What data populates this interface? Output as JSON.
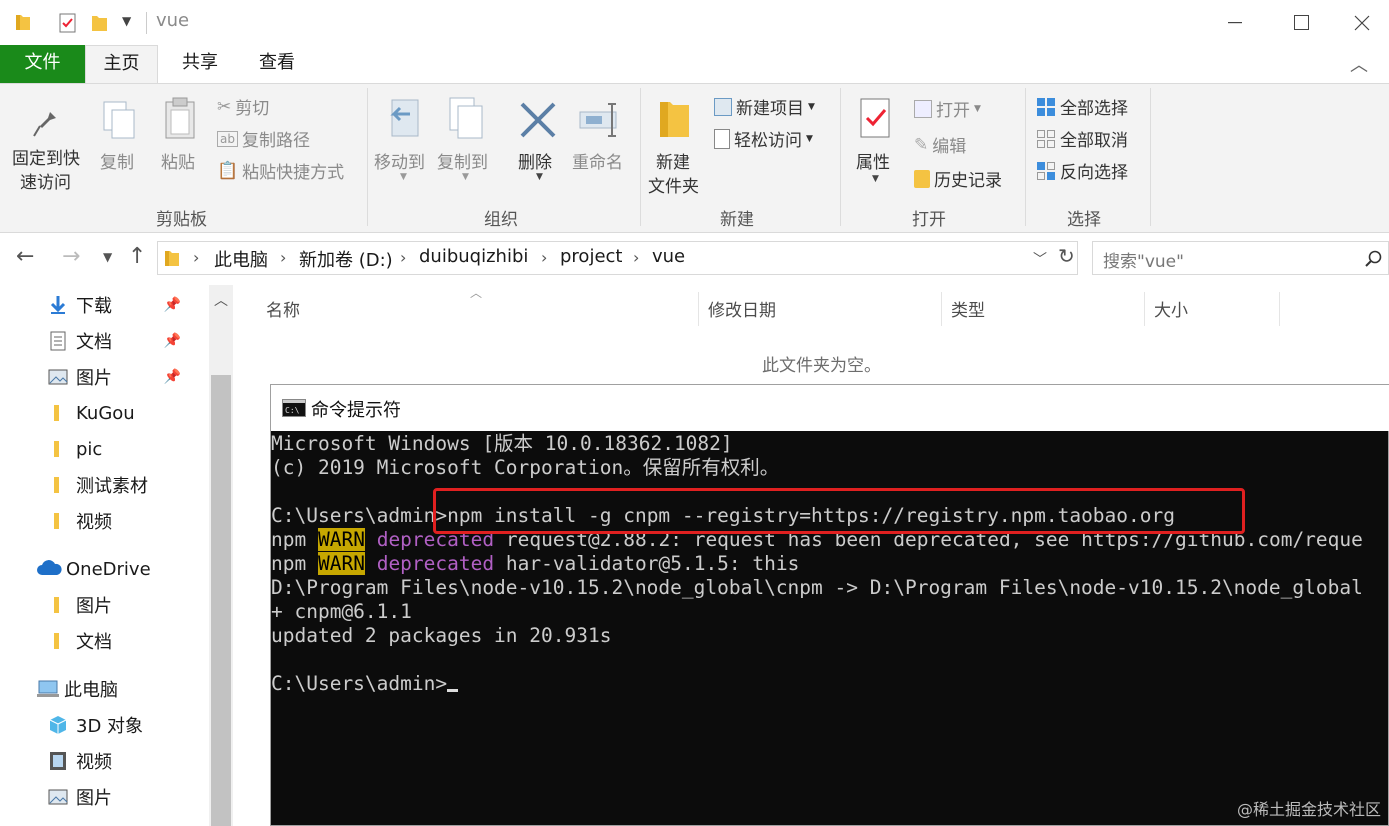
{
  "window": {
    "title": "vue"
  },
  "ribbon_tabs": [
    "文件",
    "主页",
    "共享",
    "查看"
  ],
  "ribbon": {
    "clipboard": {
      "pin": "固定到快\n速访问",
      "pin_l1": "固定到快",
      "pin_l2": "速访问",
      "copy": "复制",
      "paste": "粘贴",
      "cut": "剪切",
      "copy_path": "复制路径",
      "paste_shortcut": "粘贴快捷方式",
      "label": "剪贴板"
    },
    "organize": {
      "move_to": "移动到",
      "copy_to": "复制到",
      "delete": "删除",
      "rename": "重命名",
      "label": "组织"
    },
    "new": {
      "new_item": "新建项目",
      "easy_access": "轻松访问",
      "new_folder_l1": "新建",
      "new_folder_l2": "文件夹",
      "label": "新建"
    },
    "open": {
      "properties": "属性",
      "open": "打开",
      "edit": "编辑",
      "history": "历史记录",
      "label": "打开"
    },
    "select": {
      "select_all": "全部选择",
      "select_none": "全部取消",
      "invert": "反向选择",
      "label": "选择"
    }
  },
  "address": {
    "crumbs": [
      "此电脑",
      "新加卷 (D:)",
      "duibuqizhibi",
      "project",
      "vue"
    ],
    "search_placeholder": "搜索\"vue\""
  },
  "nav": {
    "quick": [
      {
        "label": "下载",
        "icon": "download-icon",
        "pinned": true
      },
      {
        "label": "文档",
        "icon": "document-icon",
        "pinned": true
      },
      {
        "label": "图片",
        "icon": "picture-icon",
        "pinned": true
      },
      {
        "label": "KuGou",
        "icon": "folder-icon"
      },
      {
        "label": "pic",
        "icon": "folder-icon"
      },
      {
        "label": "测试素材",
        "icon": "folder-icon"
      },
      {
        "label": "视频",
        "icon": "folder-icon"
      }
    ],
    "onedrive": "OneDrive",
    "onedrive_items": [
      "图片",
      "文档"
    ],
    "this_pc": "此电脑",
    "pc_items": [
      "3D 对象",
      "视频",
      "图片"
    ]
  },
  "file_list": {
    "columns": [
      "名称",
      "修改日期",
      "类型",
      "大小"
    ],
    "empty_message": "此文件夹为空。"
  },
  "console": {
    "title": "命令提示符",
    "line1": "Microsoft Windows [版本 10.0.18362.1082]",
    "line2": "(c) 2019 Microsoft Corporation。保留所有权利。",
    "prompt1": "C:\\Users\\admin>",
    "command": "npm install -g cnpm --registry=https://registry.npm.taobao.org",
    "npm": "npm",
    "warn": "WARN",
    "deprecated": "deprecated",
    "warn1_rest": "request@2.88.2: request has been deprecated, see https://github.com/reque",
    "warn2_rest": "har-validator@5.1.5: this",
    "link_line": "D:\\Program Files\\node-v10.15.2\\node_global\\cnpm -> D:\\Program Files\\node-v10.15.2\\node_global",
    "installed": "+ cnpm@6.1.1",
    "updated": "updated 2 packages in 20.931s",
    "prompt2": "C:\\Users\\admin>"
  },
  "watermark": "@稀土掘金技术社区",
  "colors": {
    "file_tab": "#1a8a1a",
    "highlight_box": "#e02020",
    "warn_bg": "#c6a700",
    "deprecated": "#b160c4",
    "folder": "#f4c342"
  }
}
